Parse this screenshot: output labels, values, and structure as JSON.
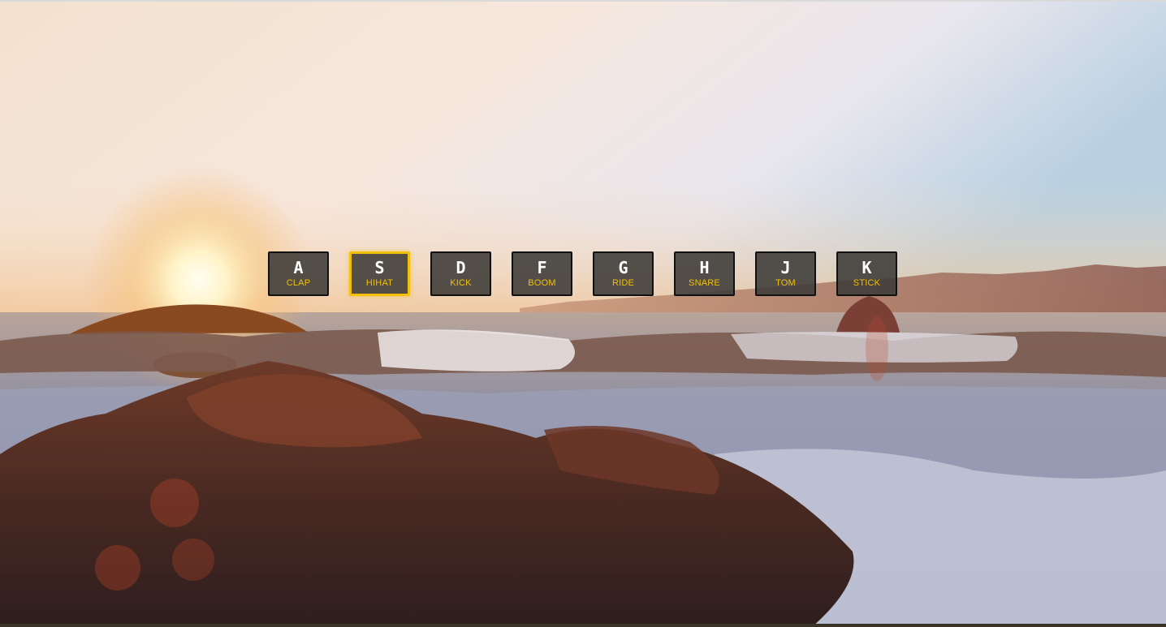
{
  "background": {
    "description_icon": "sunset-seascape-background",
    "accent_color": "#f2c00a"
  },
  "keys": [
    {
      "letter": "A",
      "sound": "CLAP",
      "playing": false
    },
    {
      "letter": "S",
      "sound": "HIHAT",
      "playing": true
    },
    {
      "letter": "D",
      "sound": "KICK",
      "playing": false
    },
    {
      "letter": "F",
      "sound": "BOOM",
      "playing": false
    },
    {
      "letter": "G",
      "sound": "RIDE",
      "playing": false
    },
    {
      "letter": "H",
      "sound": "SNARE",
      "playing": false
    },
    {
      "letter": "J",
      "sound": "TOM",
      "playing": false
    },
    {
      "letter": "K",
      "sound": "STICK",
      "playing": false
    }
  ]
}
